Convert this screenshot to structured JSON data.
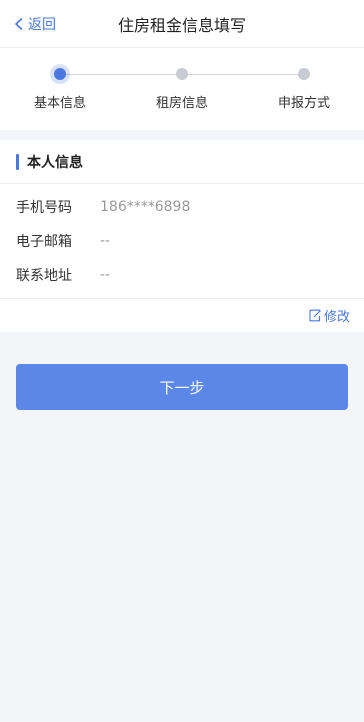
{
  "header": {
    "back_label": "返回",
    "title": "住房租金信息填写"
  },
  "steps": [
    {
      "label": "基本信息",
      "active": true
    },
    {
      "label": "租房信息",
      "active": false
    },
    {
      "label": "申报方式",
      "active": false
    }
  ],
  "section": {
    "title": "本人信息",
    "rows": [
      {
        "key": "手机号码",
        "value": "186****6898"
      },
      {
        "key": "电子邮箱",
        "value": "--"
      },
      {
        "key": "联系地址",
        "value": "--"
      }
    ],
    "edit_label": "修改"
  },
  "next_button": "下一步",
  "colors": {
    "accent": "#4a78e0",
    "button": "#5b87e8",
    "background": "#f4f5f9"
  }
}
